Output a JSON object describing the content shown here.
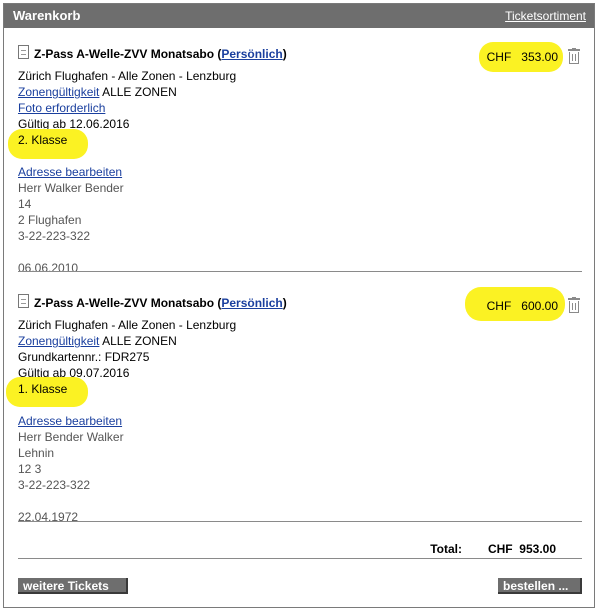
{
  "header": {
    "title": "Warenkorb",
    "link": "Ticketsortiment"
  },
  "items": [
    {
      "product": "Z-Pass A-Welle-ZVV Monatsabo",
      "paren_open": " (",
      "person_link": "Persönlich",
      "paren_close": ")",
      "route": "Zürich Flughafen - Alle Zonen - Lenzburg",
      "zone_link": "Zonengültigkeit",
      "zone_value": " ALLE ZONEN",
      "extra_link": "Foto erforderlich",
      "valid": "Gültig ab 12.06.2016",
      "class": "2. Klasse",
      "address_link": "Adresse bearbeiten",
      "address": [
        "Herr Walker Bender",
        "14",
        "2 Flughafen",
        "3-22-223-322"
      ],
      "birthdate": "06.06.2010",
      "currency": "CHF",
      "price": "353.00"
    },
    {
      "product": "Z-Pass A-Welle-ZVV Monatsabo",
      "paren_open": " (",
      "person_link": "Persönlich",
      "paren_close": ")",
      "route": "Zürich Flughafen - Alle Zonen - Lenzburg",
      "zone_link": "Zonengültigkeit",
      "zone_value": " ALLE ZONEN",
      "card_no": "Grundkartennr.: FDR275",
      "valid": "Gültig ab 09.07.2016",
      "class": "1. Klasse",
      "address_link": "Adresse bearbeiten",
      "address": [
        "Herr Bender Walker",
        "Lehnin",
        "12 3",
        "3-22-223-322"
      ],
      "birthdate": "22.04.1972",
      "currency": "CHF",
      "price": "600.00"
    }
  ],
  "total": {
    "label": "Total:",
    "currency": "CHF",
    "value": "953.00"
  },
  "buttons": {
    "more": "weitere Tickets",
    "order": "bestellen ..."
  },
  "colors": {
    "highlight": "#fbf223",
    "header_bg": "#6e6e6e",
    "link": "#1a3f9e"
  }
}
